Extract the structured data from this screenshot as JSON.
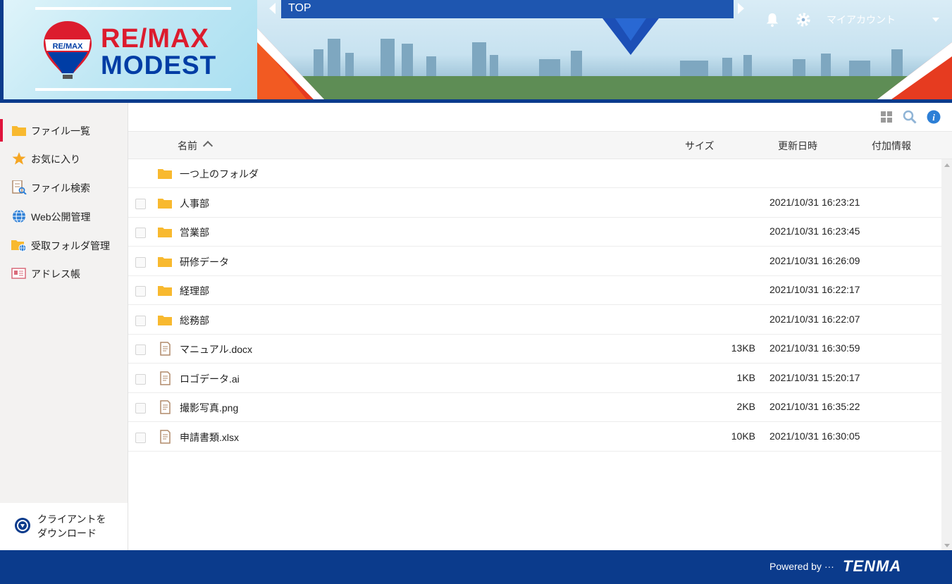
{
  "brand": {
    "line1": "RE/MAX",
    "line2": "MODEST",
    "balloon_text": "RE/MAX",
    "colors": {
      "red": "#dc1c2e",
      "blue": "#003da5"
    }
  },
  "header": {
    "breadcrumb": "TOP",
    "account_label": "マイアカウント",
    "icons": [
      "bell-icon",
      "gear-icon",
      "chevron-down-icon"
    ]
  },
  "sidebar": {
    "items": [
      {
        "label": "ファイル一覧",
        "icon": "folder-icon",
        "active": true
      },
      {
        "label": "お気に入り",
        "icon": "star-icon"
      },
      {
        "label": "ファイル検索",
        "icon": "file-search-icon"
      },
      {
        "label": "Web公開管理",
        "icon": "globe-icon"
      },
      {
        "label": "受取フォルダ管理",
        "icon": "folder-globe-icon"
      },
      {
        "label": "アドレス帳",
        "icon": "address-card-icon"
      }
    ],
    "download": {
      "line1": "クライアントを",
      "line2": "ダウンロード"
    }
  },
  "toolbar": {
    "icons": [
      "grid-view-icon",
      "search-icon",
      "info-icon"
    ]
  },
  "table": {
    "columns": {
      "name": "名前",
      "size": "サイズ",
      "updated": "更新日時",
      "extra": "付加情報"
    },
    "parent_folder": "一つ上のフォルダ",
    "rows": [
      {
        "name": "人事部",
        "type": "folder",
        "size": "",
        "date": "2021/10/31 16:23:21"
      },
      {
        "name": "営業部",
        "type": "folder",
        "size": "",
        "date": "2021/10/31 16:23:45"
      },
      {
        "name": "研修データ",
        "type": "folder",
        "size": "",
        "date": "2021/10/31 16:26:09"
      },
      {
        "name": "経理部",
        "type": "folder",
        "size": "",
        "date": "2021/10/31 16:22:17"
      },
      {
        "name": "総務部",
        "type": "folder",
        "size": "",
        "date": "2021/10/31 16:22:07"
      },
      {
        "name": "マニュアル.docx",
        "type": "file",
        "size": "13KB",
        "date": "2021/10/31 16:30:59"
      },
      {
        "name": "ロゴデータ.ai",
        "type": "file",
        "size": "1KB",
        "date": "2021/10/31 15:20:17"
      },
      {
        "name": "撮影写真.png",
        "type": "file",
        "size": "2KB",
        "date": "2021/10/31 16:35:22"
      },
      {
        "name": "申請書類.xlsx",
        "type": "file",
        "size": "10KB",
        "date": "2021/10/31 16:30:05"
      }
    ]
  },
  "footer": {
    "powered": "Powered by ···",
    "vendor": "TENMA"
  }
}
